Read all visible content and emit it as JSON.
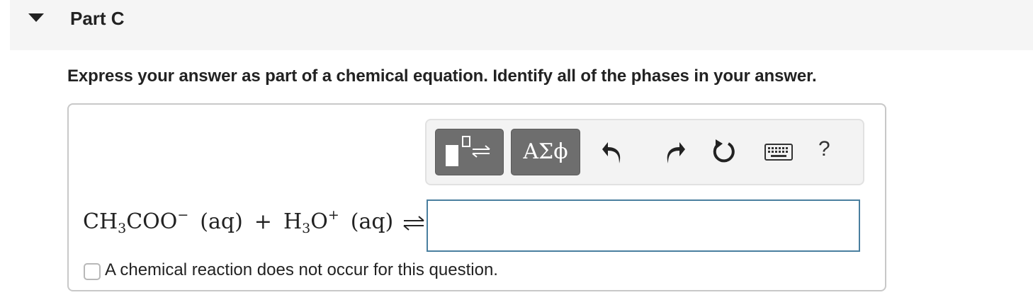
{
  "part": {
    "title": "Part C"
  },
  "instruction": "Express your answer as part of a chemical equation. Identify all of the phases in your answer.",
  "toolbar": {
    "templates_icon": "templates-arrow-icon",
    "greek_label": "ΑΣϕ",
    "undo_icon": "undo-icon",
    "redo_icon": "redo-icon",
    "reset_icon": "reset-icon",
    "keyboard_icon": "keyboard-icon",
    "help_label": "?"
  },
  "equation": {
    "species1": {
      "base": "CH",
      "sub": "3",
      "rest": "COO",
      "sup": "−",
      "phase": "(aq)"
    },
    "plus": "+",
    "species2": {
      "base": "H",
      "sub": "3",
      "rest": "O",
      "sup": "+",
      "phase": "(aq)"
    },
    "arrow": "⇌"
  },
  "answer_input": {
    "value": "",
    "placeholder": ""
  },
  "no_reaction": {
    "checked": false,
    "label": "A chemical reaction does not occur for this question."
  },
  "colors": {
    "header_bg": "#f5f5f5",
    "toolbar_button": "#6e6e6e",
    "input_border": "#4a7f9f"
  }
}
